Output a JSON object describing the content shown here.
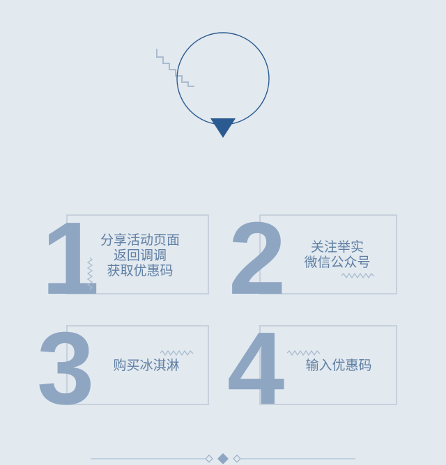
{
  "steps": [
    {
      "number": "1",
      "text": "分享活动页面\n返回调调\n获取优惠码"
    },
    {
      "number": "2",
      "text": "关注举实\n微信公众号"
    },
    {
      "number": "3",
      "text": "购买冰淇淋"
    },
    {
      "number": "4",
      "text": "输入优惠码"
    }
  ],
  "colors": {
    "background": "#e2e9ef",
    "accent": "#2a5a8f",
    "number": "#8ea6c2",
    "text": "#5f7fa3",
    "border": "#c6d1dc"
  },
  "icons": {
    "header": "circle-with-down-triangle-icon",
    "footer": "diamond-divider-icon"
  }
}
